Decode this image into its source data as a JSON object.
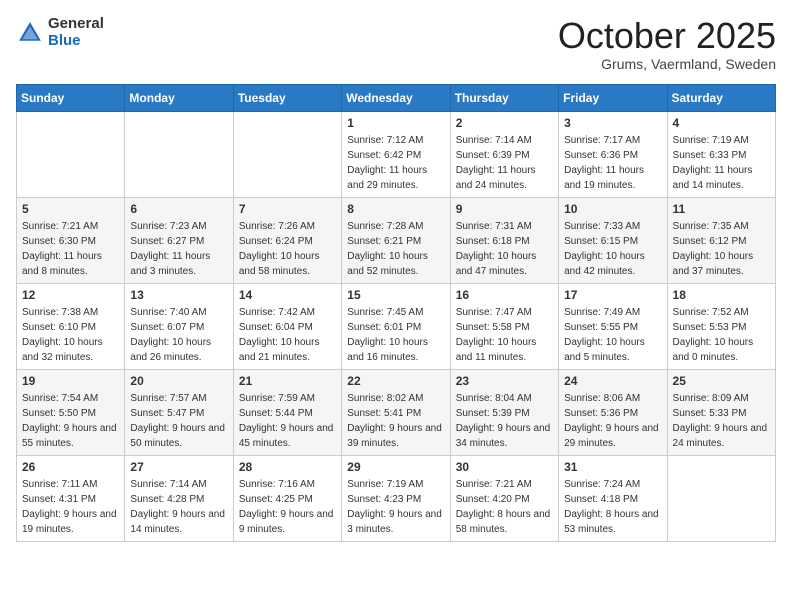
{
  "logo": {
    "general": "General",
    "blue": "Blue"
  },
  "header": {
    "month": "October 2025",
    "location": "Grums, Vaermland, Sweden"
  },
  "weekdays": [
    "Sunday",
    "Monday",
    "Tuesday",
    "Wednesday",
    "Thursday",
    "Friday",
    "Saturday"
  ],
  "weeks": [
    [
      {
        "day": "",
        "info": ""
      },
      {
        "day": "",
        "info": ""
      },
      {
        "day": "",
        "info": ""
      },
      {
        "day": "1",
        "info": "Sunrise: 7:12 AM\nSunset: 6:42 PM\nDaylight: 11 hours and 29 minutes."
      },
      {
        "day": "2",
        "info": "Sunrise: 7:14 AM\nSunset: 6:39 PM\nDaylight: 11 hours and 24 minutes."
      },
      {
        "day": "3",
        "info": "Sunrise: 7:17 AM\nSunset: 6:36 PM\nDaylight: 11 hours and 19 minutes."
      },
      {
        "day": "4",
        "info": "Sunrise: 7:19 AM\nSunset: 6:33 PM\nDaylight: 11 hours and 14 minutes."
      }
    ],
    [
      {
        "day": "5",
        "info": "Sunrise: 7:21 AM\nSunset: 6:30 PM\nDaylight: 11 hours and 8 minutes."
      },
      {
        "day": "6",
        "info": "Sunrise: 7:23 AM\nSunset: 6:27 PM\nDaylight: 11 hours and 3 minutes."
      },
      {
        "day": "7",
        "info": "Sunrise: 7:26 AM\nSunset: 6:24 PM\nDaylight: 10 hours and 58 minutes."
      },
      {
        "day": "8",
        "info": "Sunrise: 7:28 AM\nSunset: 6:21 PM\nDaylight: 10 hours and 52 minutes."
      },
      {
        "day": "9",
        "info": "Sunrise: 7:31 AM\nSunset: 6:18 PM\nDaylight: 10 hours and 47 minutes."
      },
      {
        "day": "10",
        "info": "Sunrise: 7:33 AM\nSunset: 6:15 PM\nDaylight: 10 hours and 42 minutes."
      },
      {
        "day": "11",
        "info": "Sunrise: 7:35 AM\nSunset: 6:12 PM\nDaylight: 10 hours and 37 minutes."
      }
    ],
    [
      {
        "day": "12",
        "info": "Sunrise: 7:38 AM\nSunset: 6:10 PM\nDaylight: 10 hours and 32 minutes."
      },
      {
        "day": "13",
        "info": "Sunrise: 7:40 AM\nSunset: 6:07 PM\nDaylight: 10 hours and 26 minutes."
      },
      {
        "day": "14",
        "info": "Sunrise: 7:42 AM\nSunset: 6:04 PM\nDaylight: 10 hours and 21 minutes."
      },
      {
        "day": "15",
        "info": "Sunrise: 7:45 AM\nSunset: 6:01 PM\nDaylight: 10 hours and 16 minutes."
      },
      {
        "day": "16",
        "info": "Sunrise: 7:47 AM\nSunset: 5:58 PM\nDaylight: 10 hours and 11 minutes."
      },
      {
        "day": "17",
        "info": "Sunrise: 7:49 AM\nSunset: 5:55 PM\nDaylight: 10 hours and 5 minutes."
      },
      {
        "day": "18",
        "info": "Sunrise: 7:52 AM\nSunset: 5:53 PM\nDaylight: 10 hours and 0 minutes."
      }
    ],
    [
      {
        "day": "19",
        "info": "Sunrise: 7:54 AM\nSunset: 5:50 PM\nDaylight: 9 hours and 55 minutes."
      },
      {
        "day": "20",
        "info": "Sunrise: 7:57 AM\nSunset: 5:47 PM\nDaylight: 9 hours and 50 minutes."
      },
      {
        "day": "21",
        "info": "Sunrise: 7:59 AM\nSunset: 5:44 PM\nDaylight: 9 hours and 45 minutes."
      },
      {
        "day": "22",
        "info": "Sunrise: 8:02 AM\nSunset: 5:41 PM\nDaylight: 9 hours and 39 minutes."
      },
      {
        "day": "23",
        "info": "Sunrise: 8:04 AM\nSunset: 5:39 PM\nDaylight: 9 hours and 34 minutes."
      },
      {
        "day": "24",
        "info": "Sunrise: 8:06 AM\nSunset: 5:36 PM\nDaylight: 9 hours and 29 minutes."
      },
      {
        "day": "25",
        "info": "Sunrise: 8:09 AM\nSunset: 5:33 PM\nDaylight: 9 hours and 24 minutes."
      }
    ],
    [
      {
        "day": "26",
        "info": "Sunrise: 7:11 AM\nSunset: 4:31 PM\nDaylight: 9 hours and 19 minutes."
      },
      {
        "day": "27",
        "info": "Sunrise: 7:14 AM\nSunset: 4:28 PM\nDaylight: 9 hours and 14 minutes."
      },
      {
        "day": "28",
        "info": "Sunrise: 7:16 AM\nSunset: 4:25 PM\nDaylight: 9 hours and 9 minutes."
      },
      {
        "day": "29",
        "info": "Sunrise: 7:19 AM\nSunset: 4:23 PM\nDaylight: 9 hours and 3 minutes."
      },
      {
        "day": "30",
        "info": "Sunrise: 7:21 AM\nSunset: 4:20 PM\nDaylight: 8 hours and 58 minutes."
      },
      {
        "day": "31",
        "info": "Sunrise: 7:24 AM\nSunset: 4:18 PM\nDaylight: 8 hours and 53 minutes."
      },
      {
        "day": "",
        "info": ""
      }
    ]
  ]
}
